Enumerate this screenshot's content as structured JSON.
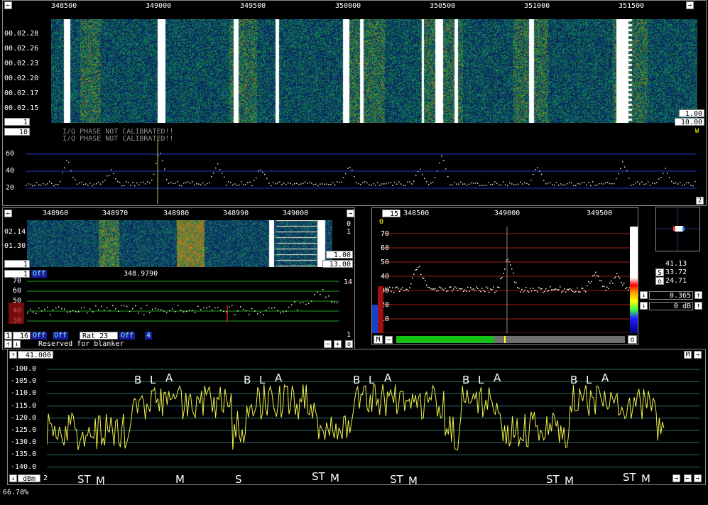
{
  "top_freq_ticks": [
    "348500",
    "349000",
    "349500",
    "350000",
    "350500",
    "351000",
    "351500"
  ],
  "wf_times": [
    "00.02.28",
    "00.02.26",
    "00.02.23",
    "00.02.20",
    "00.02.17",
    "00.02.15"
  ],
  "wf_speed": "1.00",
  "wf_level": "10.00",
  "wf_level_small": "1",
  "marker_w": "W",
  "wide_spec": {
    "avg": "10",
    "warn1": "I/Q PHASE NOT CALIBRATED!!",
    "warn2": "I/Q PHASE NOT CALIBRATED!!",
    "yticks": [
      "60",
      "40",
      "20"
    ],
    "right_num": "2",
    "right_num2": "1"
  },
  "zoom": {
    "freq_ticks": [
      "348960",
      "348970",
      "348980",
      "348990",
      "349000"
    ],
    "times": [
      "02.14",
      "01.30"
    ],
    "r0": "0",
    "r1": "1",
    "speed": "1.00",
    "level": "13.00",
    "freq": "348.9790",
    "off": "Off",
    "yticks": [
      "70",
      "60",
      "50",
      "40",
      "30"
    ],
    "right14": "14",
    "right1": "1",
    "num16": "16",
    "btn_a": "Off",
    "btn_b": "Off",
    "rat": "Rat 23",
    "btn_c": "Off",
    "btn_d": "4",
    "blanker": "Reserved for blanker",
    "m1": "1",
    "m2": "1",
    "m3": "1"
  },
  "mid": {
    "top_num": "15",
    "freq_ticks": [
      "348500",
      "349000",
      "349500"
    ],
    "zero": "0",
    "yticks": [
      "70",
      "60",
      "50",
      "40",
      "30",
      "20",
      "10"
    ],
    "m": "M",
    "o": "o"
  },
  "meters": {
    "v1": "41.13",
    "v2": "33.72",
    "v3": "24.71",
    "s": "S",
    "o": "o",
    "v4": "0.365",
    "v5": "0 dB"
  },
  "baseband": {
    "ref": "41.000",
    "m_btn": "M",
    "yticks": [
      "-100.0",
      "-105.0",
      "-110.0",
      "-115.0",
      "-120.0",
      "-125.0",
      "-130.0",
      "-135.0",
      "-140.0"
    ],
    "unit": "dBm",
    "unit_num": "2",
    "top_letters": [
      "B",
      "L",
      "A"
    ],
    "bottom_labels": [
      [
        "ST",
        "M"
      ],
      [
        "M"
      ],
      [
        "S"
      ],
      [
        "ST",
        "M"
      ],
      [
        "ST",
        "M"
      ],
      [
        "ST",
        "M"
      ],
      [
        "ST",
        "M"
      ]
    ]
  },
  "status": "66.78%",
  "colors": {
    "trace_yellow": "#f2f24a",
    "grid_blue": "#1c3cc8",
    "grid_green": "#20a020",
    "grid_red": "#a02010",
    "baseband_grid": "#2a6d6d"
  }
}
